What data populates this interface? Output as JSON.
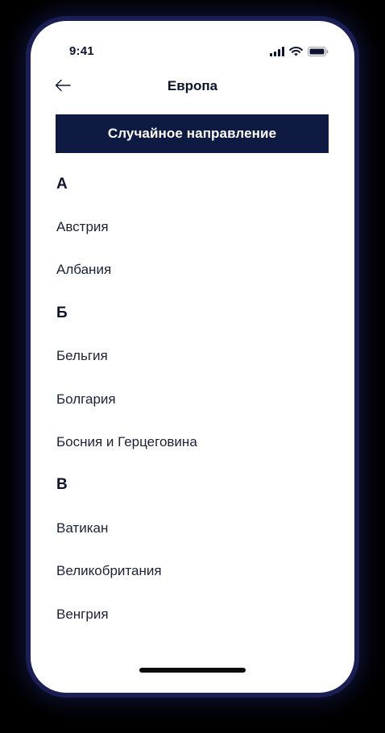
{
  "status_bar": {
    "time": "9:41",
    "icons": [
      "cellular-signal-icon",
      "wifi-icon",
      "battery-icon"
    ]
  },
  "header": {
    "back_icon": "arrow-left-icon",
    "title": "Европа"
  },
  "random_button": {
    "label": "Случайное направление"
  },
  "sections": [
    {
      "letter": "А",
      "countries": [
        "Австрия",
        "Албания"
      ]
    },
    {
      "letter": "Б",
      "countries": [
        "Бельгия",
        "Болгария",
        "Босния и Герцеговина"
      ]
    },
    {
      "letter": "В",
      "countries": [
        "Ватикан",
        "Великобритания",
        "Венгрия"
      ]
    }
  ],
  "colors": {
    "accent": "#0e1a42",
    "text": "#0d1430",
    "background": "#ffffff"
  }
}
